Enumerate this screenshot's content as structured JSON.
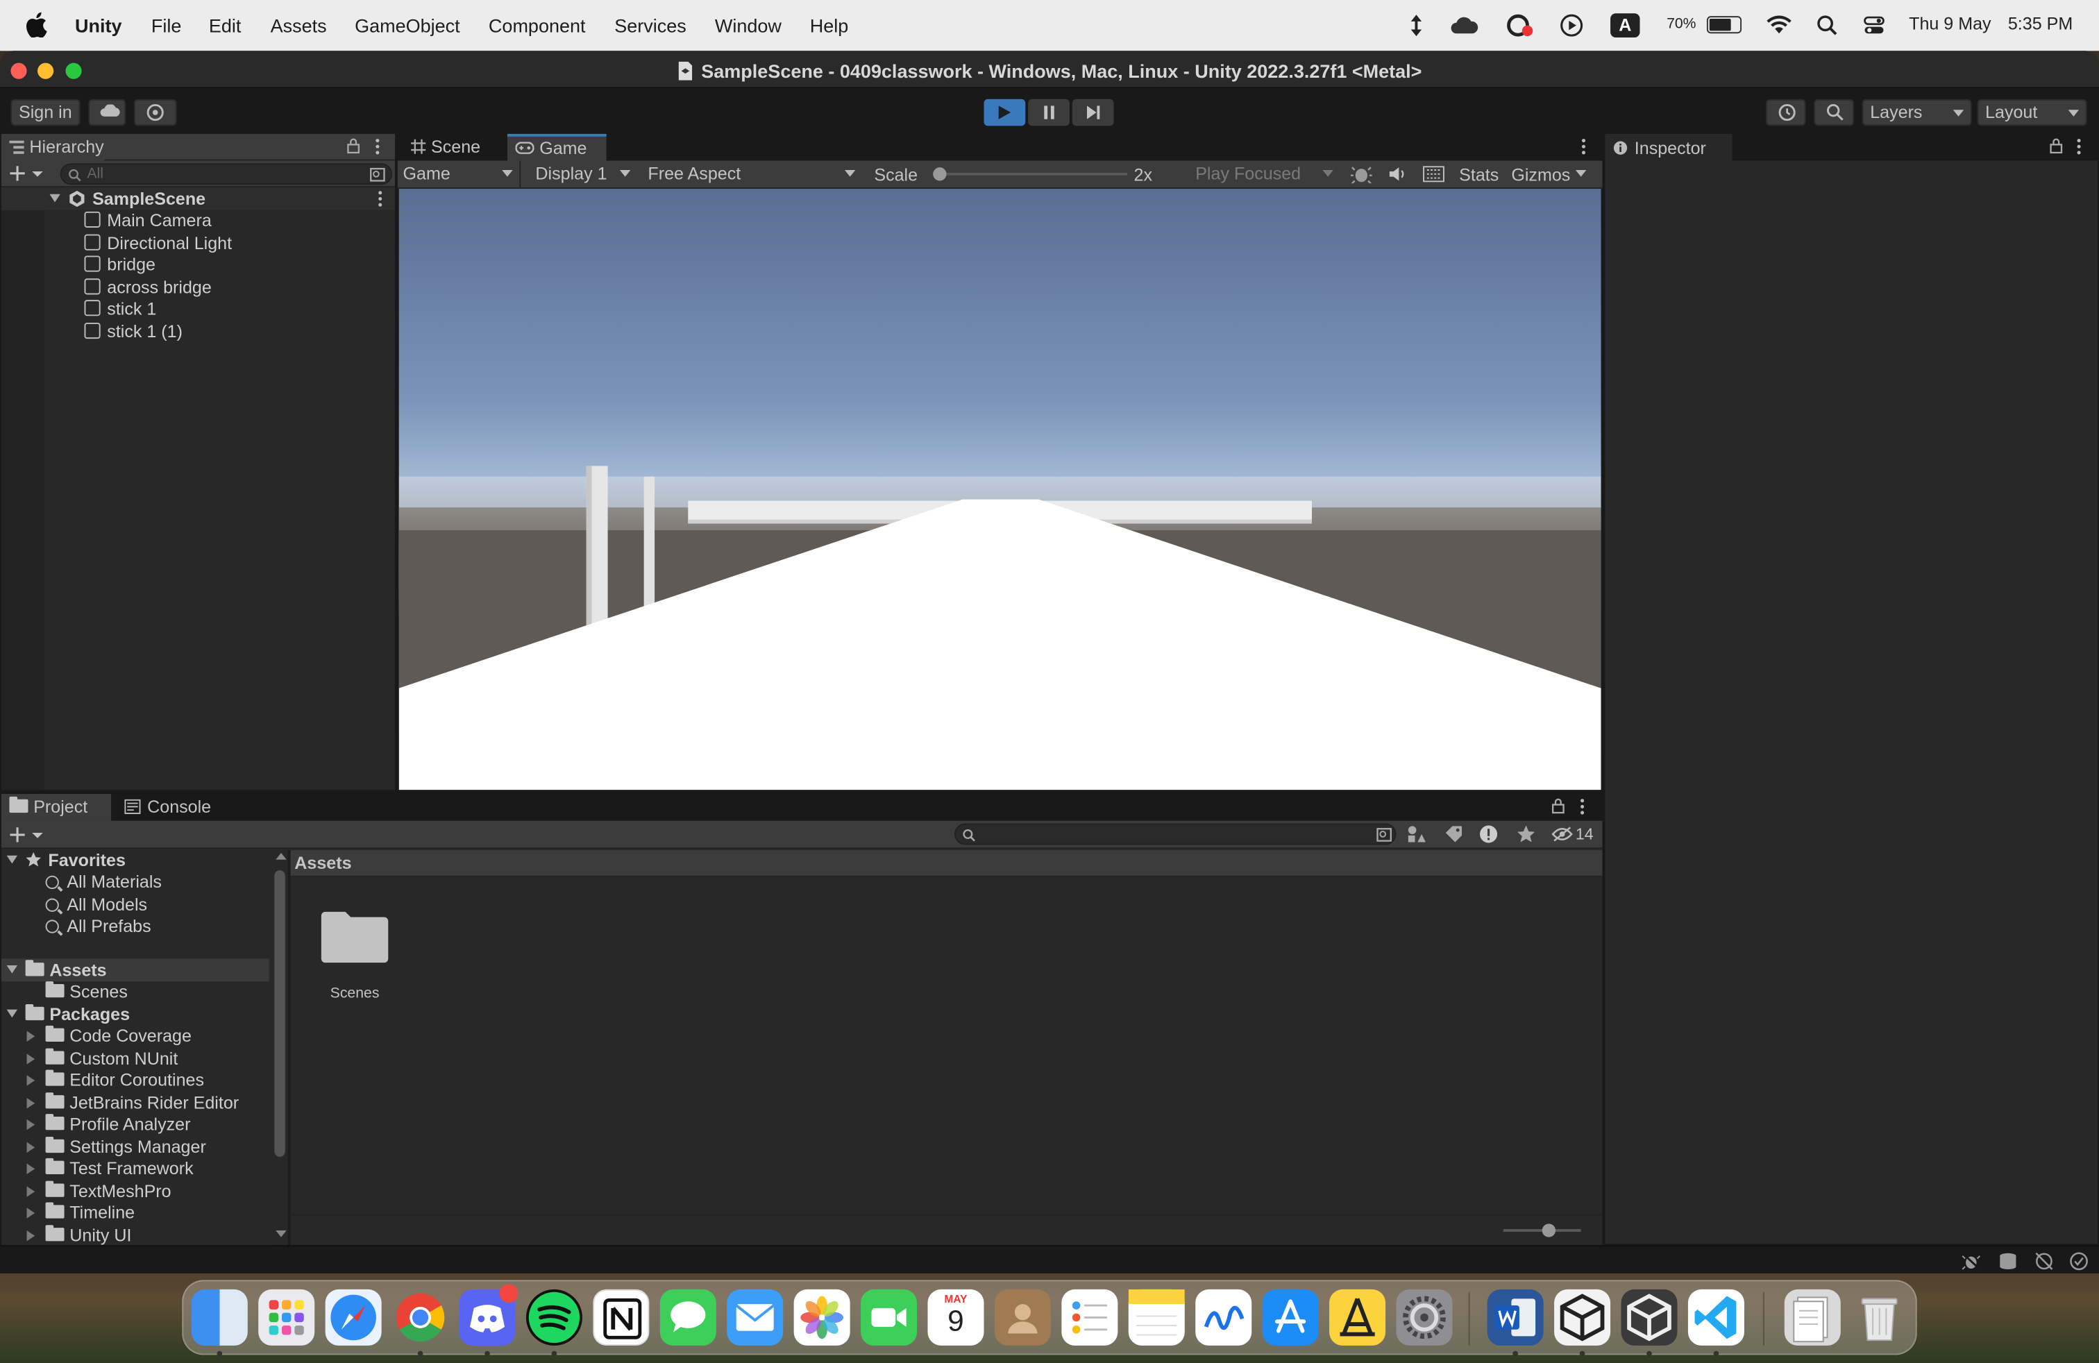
{
  "menubar": {
    "app_name": "Unity",
    "items": [
      "File",
      "Edit",
      "Assets",
      "GameObject",
      "Component",
      "Services",
      "Window",
      "Help"
    ],
    "battery": "70%",
    "clock_date": "Thu 9 May",
    "clock_time": "5:35 PM"
  },
  "window": {
    "title": "SampleScene - 0409classwork - Windows, Mac, Linux - Unity 2022.3.27f1 <Metal>"
  },
  "toolbar": {
    "sign_in": "Sign in",
    "layers": "Layers",
    "layout": "Layout"
  },
  "hierarchy": {
    "tab": "Hierarchy",
    "search_placeholder": "All",
    "scene": "SampleScene",
    "objects": [
      "Main Camera",
      "Directional Light",
      "bridge",
      "across bridge",
      "stick 1",
      "stick 1 (1)"
    ]
  },
  "game_panel": {
    "tabs": [
      "Scene",
      "Game"
    ],
    "active_tab": "Game",
    "view_mode": "Game",
    "display": "Display 1",
    "aspect": "Free Aspect",
    "scale_label": "Scale",
    "scale_value": "2x",
    "scale_fraction": 0.0,
    "play_mode": "Play Focused",
    "stats": "Stats",
    "gizmos": "Gizmos"
  },
  "inspector": {
    "tab": "Inspector"
  },
  "project": {
    "tabs": [
      "Project",
      "Console"
    ],
    "hidden_count": "14",
    "favorites": {
      "label": "Favorites",
      "items": [
        "All Materials",
        "All Models",
        "All Prefabs"
      ]
    },
    "assets": {
      "label": "Assets",
      "items": [
        "Scenes"
      ]
    },
    "packages": {
      "label": "Packages",
      "items": [
        "Code Coverage",
        "Custom NUnit",
        "Editor Coroutines",
        "JetBrains Rider Editor",
        "Profile Analyzer",
        "Settings Manager",
        "Test Framework",
        "TextMeshPro",
        "Timeline",
        "Unity UI"
      ]
    },
    "breadcrumb": "Assets",
    "grid_items": [
      {
        "name": "Scenes"
      }
    ]
  },
  "colors": {
    "accent_blue": "#3a79bb",
    "panel_bg": "#282828",
    "toolbar_bg": "#191919"
  },
  "dock": {
    "calendar_month": "MAY",
    "calendar_day": "9",
    "apps": [
      "Finder",
      "Launchpad",
      "Safari",
      "Chrome",
      "Discord",
      "Spotify",
      "Notion",
      "Messages",
      "Mail",
      "Photos",
      "FaceTime",
      "Calendar",
      "Contacts",
      "Reminders",
      "Notes",
      "Freeform",
      "App Store",
      "Instruments",
      "System Settings",
      "Word",
      "Unity Hub",
      "Unity",
      "Visual Studio Code",
      "Documents",
      "Trash"
    ]
  }
}
